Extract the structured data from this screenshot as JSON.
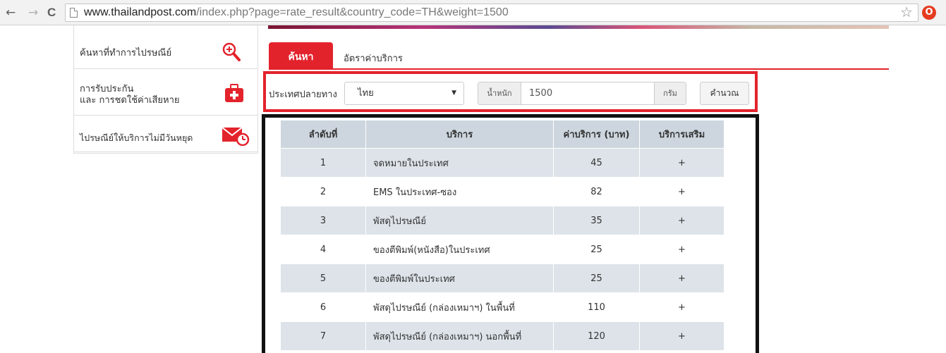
{
  "browser": {
    "url_domain": "www.thailandpost.com",
    "url_path": "/index.php?page=rate_result&country_code=TH&weight=1500",
    "back_icon": "←",
    "forward_icon": "→",
    "reload_icon": "C",
    "star_icon": "☆",
    "ext_icon": "O"
  },
  "sidebar": {
    "items": [
      {
        "label": "ค้นหาที่ทำการไปรษณีย์",
        "icon": "search-plus-icon"
      },
      {
        "label_line1": "การรับประกัน",
        "label_line2": "และ การชดใช้ค่าเสียหาย",
        "icon": "first-aid-kit-icon"
      },
      {
        "label": "ไปรษณีย์ให้บริการไม่มีวันหยุด",
        "icon": "mail-clock-icon"
      }
    ]
  },
  "tabs": {
    "search": "ค้นหา",
    "rates": "อัตราค่าบริการ"
  },
  "form": {
    "destination_label": "ประเทศปลายทาง",
    "destination_value": "ไทย",
    "weight_label": "น้ำหนัก",
    "weight_value": "1500",
    "weight_unit": "กรัม",
    "calculate_button": "คำนวณ"
  },
  "table": {
    "headers": [
      "ลำดับที่",
      "บริการ",
      "ค่าบริการ (บาท)",
      "บริการเสริม"
    ],
    "rows": [
      {
        "no": "1",
        "service": "จดหมายในประเทศ",
        "price": "45",
        "extra": "+"
      },
      {
        "no": "2",
        "service": "EMS ในประเทศ-ซอง",
        "price": "82",
        "extra": "+"
      },
      {
        "no": "3",
        "service": "พัสดุไปรษณีย์",
        "price": "35",
        "extra": "+"
      },
      {
        "no": "4",
        "service": "ของตีพิมพ์(หนังสือ)ในประเทศ",
        "price": "25",
        "extra": "+"
      },
      {
        "no": "5",
        "service": "ของตีพิมพ์ในประเทศ",
        "price": "25",
        "extra": "+"
      },
      {
        "no": "6",
        "service": "พัสดุไปรษณีย์ (กล่องเหมาฯ) ในพื้นที่",
        "price": "110",
        "extra": "+"
      },
      {
        "no": "7",
        "service": "พัสดุไปรษณีย์ (กล่องเหมาฯ) นอกพื้นที่",
        "price": "120",
        "extra": "+"
      }
    ]
  },
  "colors": {
    "brand_red": "#e3232c",
    "header_bg": "#cdd6df",
    "stripe_bg": "#dde3e9",
    "outline_black": "#111111"
  }
}
